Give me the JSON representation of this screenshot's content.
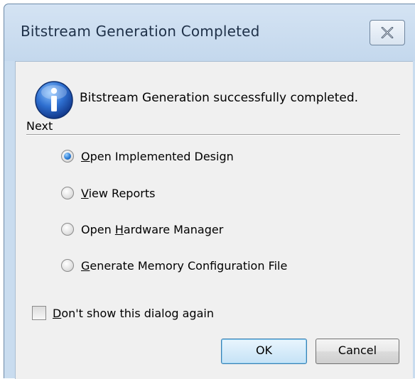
{
  "window": {
    "title": "Bitstream Generation Completed"
  },
  "message": "Bitstream Generation successfully completed.",
  "section": {
    "label": "Next"
  },
  "options": [
    {
      "pre": "",
      "ul": "O",
      "post": "pen Implemented Design",
      "checked": true
    },
    {
      "pre": "",
      "ul": "V",
      "post": "iew Reports",
      "checked": false
    },
    {
      "pre": "Open ",
      "ul": "H",
      "post": "ardware Manager",
      "checked": false
    },
    {
      "pre": "",
      "ul": "G",
      "post": "enerate Memory Configuration File",
      "checked": false
    }
  ],
  "dont_show": {
    "ul": "D",
    "post": "on't show this dialog again",
    "checked": false
  },
  "buttons": {
    "ok": "OK",
    "cancel": "Cancel"
  },
  "icons": {
    "close": "close-icon",
    "info": "info-icon"
  },
  "colors": {
    "accent": "#2f7fd6",
    "titlebar": "#c9dcef",
    "client": "#f0f0f0"
  }
}
